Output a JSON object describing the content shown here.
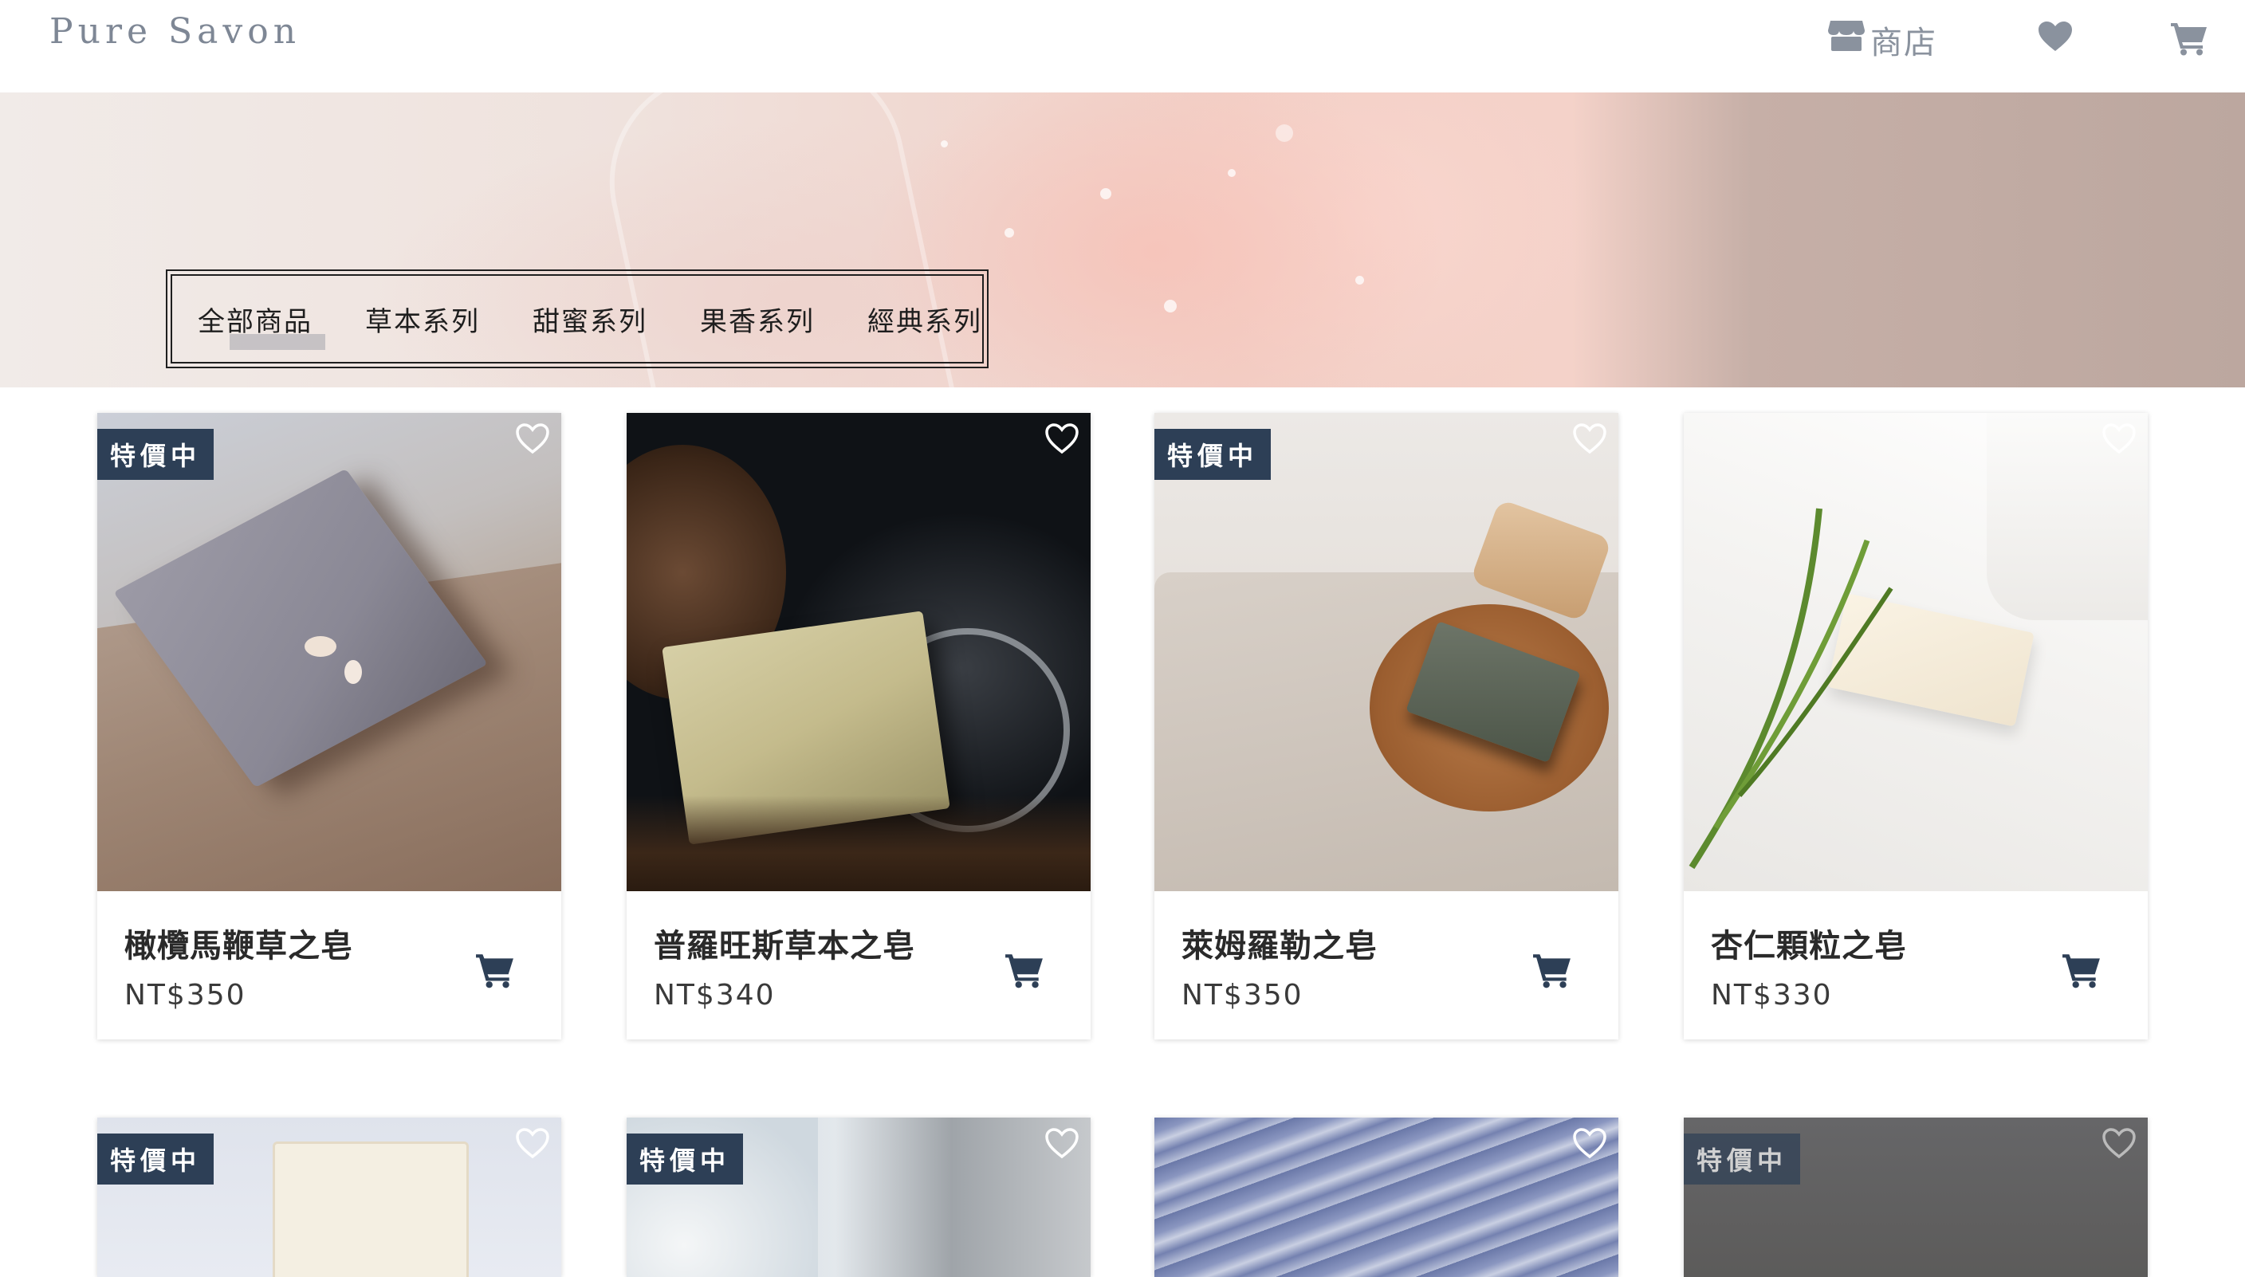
{
  "header": {
    "logo": "Pure Savon",
    "shop_label": "商店",
    "icons": [
      "store-icon",
      "heart-icon",
      "cart-icon"
    ]
  },
  "filters": {
    "tabs": [
      "全部商品",
      "草本系列",
      "甜蜜系列",
      "果香系列",
      "經典系列"
    ],
    "active": "全部商品"
  },
  "colors": {
    "badge": "#2d3f56",
    "cart_icon": "#2d3f56",
    "logo": "#7e8795",
    "nav_icon": "#8a929e"
  },
  "products": [
    {
      "name": "橄欖馬鞭草之皂",
      "price": "NT$350",
      "badge": "特價中"
    },
    {
      "name": "普羅旺斯草本之皂",
      "price": "NT$340",
      "badge": ""
    },
    {
      "name": "萊姆羅勒之皂",
      "price": "NT$350",
      "badge": "特價中"
    },
    {
      "name": "杏仁顆粒之皂",
      "price": "NT$330",
      "badge": ""
    }
  ],
  "products_row2": [
    {
      "badge": "特價中"
    },
    {
      "badge": "特價中"
    },
    {
      "badge": ""
    },
    {
      "badge": "特價中"
    }
  ]
}
